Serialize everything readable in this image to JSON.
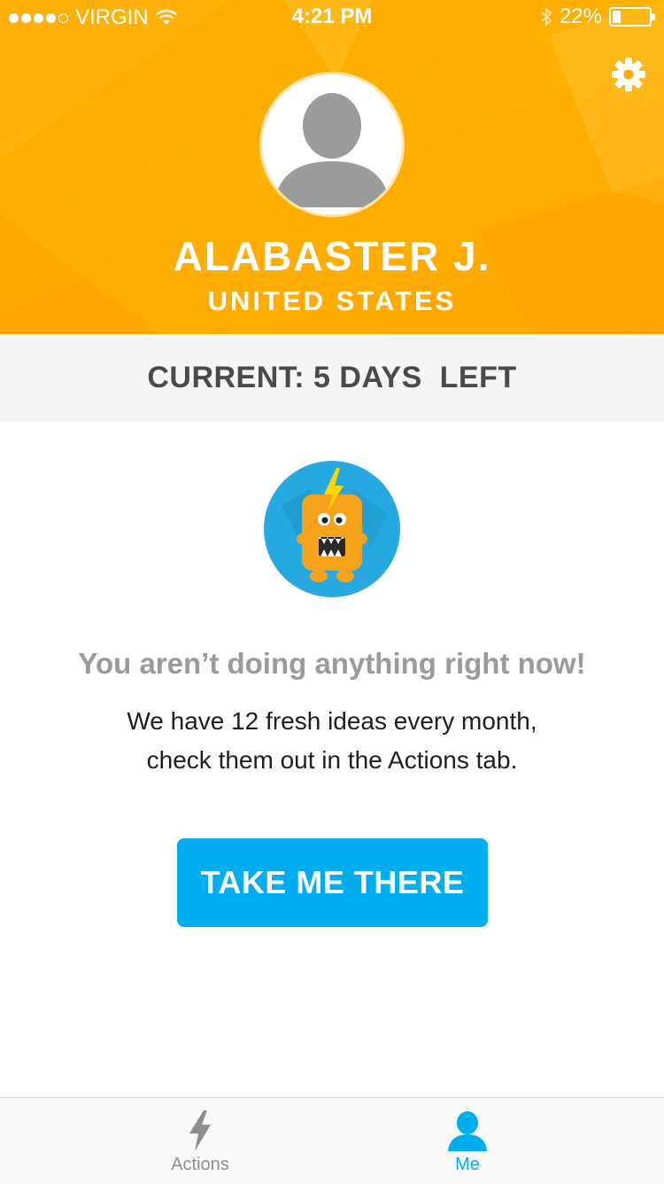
{
  "status_bar": {
    "carrier": "VIRGIN",
    "time": "4:21 PM",
    "battery": "22%",
    "battery_level": 0.22
  },
  "profile": {
    "name": "ALABASTER J.",
    "country": "UNITED STATES",
    "avatar_icon": "default-user-icon",
    "settings_icon": "gear-icon"
  },
  "current": {
    "text": "CURRENT: 5 DAYS  LEFT"
  },
  "empty_state": {
    "illustration": "monster-icon",
    "title": "You aren’t doing anything right now!",
    "body": "We have 12 fresh ideas every month, check them out in the Actions tab.",
    "button_label": "TAKE ME THERE"
  },
  "tabs": {
    "actions": {
      "label": "Actions",
      "icon": "lightning-icon"
    },
    "me": {
      "label": "Me",
      "icon": "person-icon",
      "selected": true
    }
  },
  "colors": {
    "header": "#ffab00",
    "accent": "#00aeef",
    "current_bar": "#f5f5f3",
    "monster": "#f7a21b"
  }
}
